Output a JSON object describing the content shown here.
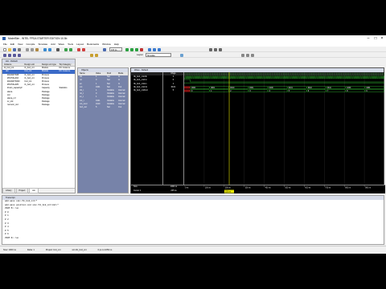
{
  "window": {
    "title": "ModelSim - INTEL FPGA STARTER EDITION 10.5b"
  },
  "menu": [
    "File",
    "Edit",
    "View",
    "Compile",
    "Simulate",
    "Add",
    "Wave",
    "Tools",
    "Layout",
    "Bookmarks",
    "Window",
    "Help"
  ],
  "toolbar": {
    "layout_label": "Layout",
    "layout_value": "Simulate",
    "sim_time": "100 ps"
  },
  "sim_panel": {
    "title": "sim - Default",
    "headers": [
      "Instance",
      "Design unit",
      "Design unit type",
      "Top Category"
    ],
    "rows": [
      [
        "tb_bcd_cnt",
        "tb_bcd_cnt",
        "Module",
        "DU Instance"
      ],
      [
        "dut",
        "bcd_cnt",
        "Module",
        "DU Instance"
      ],
      [
        "#ALWAYS#8",
        "tb_bcd_cnt",
        "Process",
        ""
      ],
      [
        "#INITIAL#16",
        "tb_bcd_cnt",
        "Process",
        ""
      ],
      [
        "#ALWAYS#20",
        "bcd_cnt",
        "Process",
        ""
      ],
      [
        "#INITIAL#25",
        "tb_bcd_cnt",
        "Process",
        ""
      ],
      [
        "#vsim_capacity#",
        "",
        "Capacity",
        "Statistics"
      ],
      [
        "altera",
        "",
        "Package",
        ""
      ],
      [
        "std",
        "",
        "Package",
        ""
      ],
      [
        "altera_mf",
        "",
        "Package",
        ""
      ],
      [
        "sv_std",
        "",
        "Package",
        ""
      ],
      [
        "numeric_std",
        "",
        "Package",
        ""
      ]
    ],
    "tabs": [
      "Library",
      "Project",
      "sim"
    ]
  },
  "objects_panel": {
    "title": "Objects",
    "headers": [
      "Name",
      "Value",
      "Kind",
      "Mode"
    ],
    "rows": [
      [
        "clk",
        "1",
        "Net",
        "In"
      ],
      [
        "rst",
        "0",
        "Net",
        "In"
      ],
      [
        "en",
        "1",
        "Net",
        "In"
      ],
      [
        "cnt",
        "0101",
        "Net",
        "Out"
      ],
      [
        "clk_t",
        "1",
        "Variable",
        "Internal"
      ],
      [
        "rst_t",
        "0",
        "Variable",
        "Internal"
      ],
      [
        "en_t",
        "1",
        "Variable",
        "Internal"
      ],
      [
        "cnt_t",
        "0101",
        "Variable",
        "Internal"
      ],
      [
        "cnt_next",
        "0110",
        "Variable",
        "Internal"
      ],
      [
        "bcd_out",
        "5",
        "Net",
        "Out"
      ]
    ]
  },
  "wave_panel": {
    "title": "Wave - Default",
    "header_msgs": "Msgs",
    "signals": [
      {
        "name": "/tb_bcd_cnt/clk",
        "value": "1"
      },
      {
        "name": "/tb_bcd_cnt/rst",
        "value": "0"
      },
      {
        "name": "/tb_bcd_cnt/en",
        "value": "1"
      },
      {
        "name": "/tb_bcd_cnt/cnt",
        "value": "0101"
      },
      {
        "name": "/tb_bcd_cnt/bcd",
        "value": "5"
      }
    ],
    "bus_values": [
      "0000",
      "0001",
      "0010",
      "0011",
      "0100",
      "0101",
      "0110",
      "0111",
      "1000",
      "1001"
    ],
    "now_label": "Now",
    "now_value": "1000 ns",
    "cursor_label": "Cursor 1",
    "cursor_value": "225 ns",
    "cursor_marker": "225 ns",
    "timeline": [
      "0 ns",
      "100 ns",
      "200 ns",
      "300 ns",
      "400 ns",
      "500 ns",
      "600 ns",
      "700 ns",
      "800 ns",
      "900 ns"
    ]
  },
  "transcript": {
    "title": "Transcript",
    "lines": [
      "add wave sim:/tb_bcd_cnt/*",
      "add wave position end sim:/tb_bcd_cnt/dut/*",
      "VSIM 5> run",
      "# 0",
      "# 1",
      "# 2",
      "# 3",
      "# 4",
      "# 5",
      "# 6",
      "VSIM 6> run",
      "",
      "",
      "VSIM 7>"
    ]
  },
  "status": {
    "now": "Now: 1000 ns",
    "delta": "Delta: 1",
    "project": "Project: bcd_cnt",
    "sim": "sim:/tb_bcd_cnt",
    "range": "0 ps to 1050 ns"
  }
}
